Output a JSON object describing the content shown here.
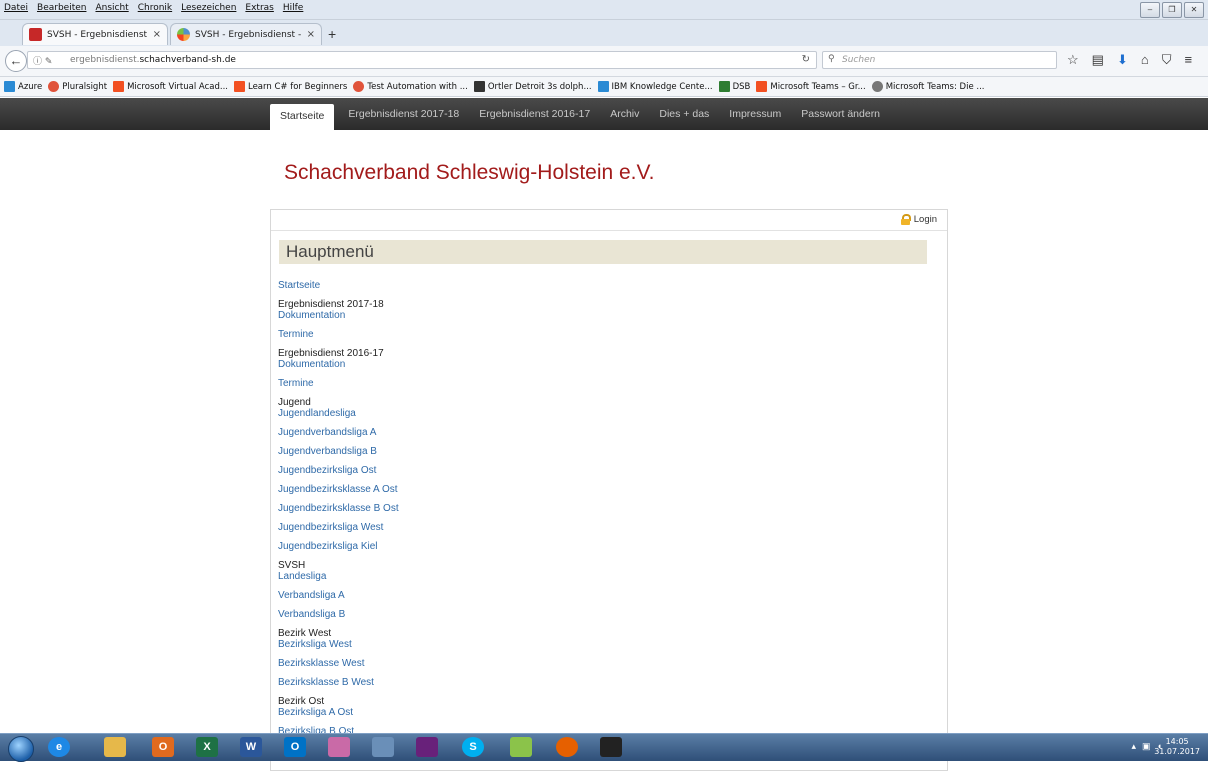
{
  "browser": {
    "menu": [
      "Datei",
      "Bearbeiten",
      "Ansicht",
      "Chronik",
      "Lesezeichen",
      "Extras",
      "Hilfe"
    ],
    "tabs": [
      {
        "title": "SVSH - Ergebnisdienst - SVSH",
        "close": "×"
      },
      {
        "title": "SVSH - Ergebnisdienst - Adm",
        "close": "×"
      }
    ],
    "new_tab": "+",
    "url_prefix": "ergebnisdienst.",
    "url_domain": "schachverband-sh.de",
    "search_placeholder": "Suchen",
    "bookmarks": [
      {
        "label": "Azure",
        "color": "#2a8ad4"
      },
      {
        "label": "Pluralsight",
        "color": "#e0533b"
      },
      {
        "label": "Microsoft Virtual Acad...",
        "color": "#f25022"
      },
      {
        "label": "Learn C# for Beginners",
        "color": "#f25022"
      },
      {
        "label": "Test Automation with ...",
        "color": "#e0533b"
      },
      {
        "label": "Ortler Detroit 3s dolph...",
        "color": "#333333"
      },
      {
        "label": "IBM Knowledge Cente...",
        "color": "#2a8ad4"
      },
      {
        "label": "DSB",
        "color": "#2e7d32"
      },
      {
        "label": "Microsoft Teams – Gr...",
        "color": "#f25022"
      },
      {
        "label": "Microsoft Teams: Die ...",
        "color": "#777777"
      }
    ]
  },
  "site": {
    "nav": [
      "Startseite",
      "Ergebnisdienst 2017-18",
      "Ergebnisdienst 2016-17",
      "Archiv",
      "Dies + das",
      "Impressum",
      "Passwort ändern"
    ],
    "title": "Schachverband Schleswig-Holstein e.V.",
    "login": "Login",
    "menu_title": "Hauptmenü",
    "menu": [
      {
        "type": "link",
        "label": "Startseite",
        "gap": 10
      },
      {
        "type": "head",
        "label": "Ergebnisdienst 2017-18",
        "gap": 0
      },
      {
        "type": "link",
        "label": "Dokumentation",
        "gap": 10
      },
      {
        "type": "link",
        "label": "Termine",
        "gap": 10
      },
      {
        "type": "head",
        "label": "Ergebnisdienst 2016-17",
        "gap": 0
      },
      {
        "type": "link",
        "label": "Dokumentation",
        "gap": 10
      },
      {
        "type": "link",
        "label": "Termine",
        "gap": 10
      },
      {
        "type": "head",
        "label": "Jugend",
        "gap": 0
      },
      {
        "type": "link",
        "label": "Jugendlandesliga",
        "gap": 10
      },
      {
        "type": "link",
        "label": "Jugendverbandsliga A",
        "gap": 10
      },
      {
        "type": "link",
        "label": "Jugendverbandsliga B",
        "gap": 10
      },
      {
        "type": "link",
        "label": "Jugendbezirksliga Ost",
        "gap": 10
      },
      {
        "type": "link",
        "label": "Jugendbezirksklasse A Ost",
        "gap": 10
      },
      {
        "type": "link",
        "label": "Jugendbezirksklasse B Ost",
        "gap": 10
      },
      {
        "type": "link",
        "label": "Jugendbezirksliga West",
        "gap": 10
      },
      {
        "type": "link",
        "label": "Jugendbezirksliga Kiel",
        "gap": 10
      },
      {
        "type": "head",
        "label": "SVSH",
        "gap": 0
      },
      {
        "type": "link",
        "label": "Landesliga",
        "gap": 10
      },
      {
        "type": "link",
        "label": "Verbandsliga A",
        "gap": 10
      },
      {
        "type": "link",
        "label": "Verbandsliga B",
        "gap": 10
      },
      {
        "type": "head",
        "label": "Bezirk West",
        "gap": 0
      },
      {
        "type": "link",
        "label": "Bezirksliga West",
        "gap": 10
      },
      {
        "type": "link",
        "label": "Bezirksklasse West",
        "gap": 10
      },
      {
        "type": "link",
        "label": "Bezirksklasse B West",
        "gap": 10
      },
      {
        "type": "head",
        "label": "Bezirk Ost",
        "gap": 0
      },
      {
        "type": "link",
        "label": "Bezirksliga A Ost",
        "gap": 10
      },
      {
        "type": "link",
        "label": "Bezirksliga B Ost",
        "gap": 10
      }
    ]
  },
  "taskbar": {
    "apps": [
      {
        "name": "ie-icon",
        "label": "e",
        "color": "#1e88e5"
      },
      {
        "name": "explorer-icon",
        "label": "",
        "color": "#e6b84a"
      },
      {
        "name": "media-icon",
        "label": "O",
        "color": "#e06a1f"
      },
      {
        "name": "excel-icon",
        "label": "X",
        "color": "#1e7145"
      },
      {
        "name": "word-icon",
        "label": "W",
        "color": "#2b579a"
      },
      {
        "name": "outlook-icon",
        "label": "O",
        "color": "#0072c6"
      },
      {
        "name": "paint-icon",
        "label": "",
        "color": "#c96aa7"
      },
      {
        "name": "settings-icon",
        "label": "",
        "color": "#6a8fb8"
      },
      {
        "name": "visual-studio-icon",
        "label": "",
        "color": "#68217a"
      },
      {
        "name": "skype-icon",
        "label": "S",
        "color": "#00aff0"
      },
      {
        "name": "notepad-icon",
        "label": "",
        "color": "#8bc34a"
      },
      {
        "name": "firefox-icon",
        "label": "",
        "color": "#e66000"
      },
      {
        "name": "app-icon",
        "label": "",
        "color": "#222222"
      }
    ],
    "time": "14:05",
    "date": "31.07.2017"
  }
}
